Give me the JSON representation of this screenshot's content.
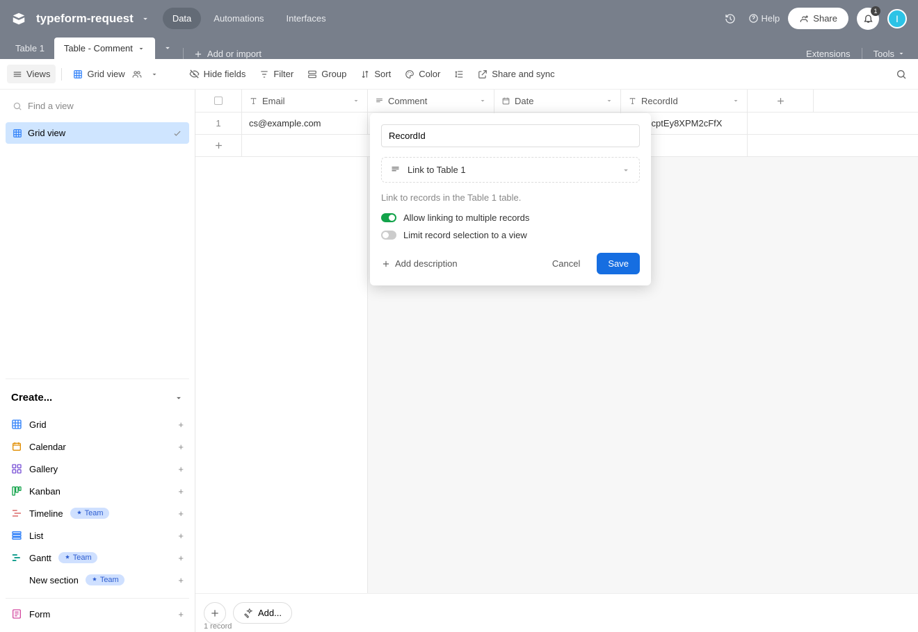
{
  "header": {
    "base_name": "typeform-request",
    "tabs": {
      "data": "Data",
      "automations": "Automations",
      "interfaces": "Interfaces"
    },
    "help": "Help",
    "share": "Share",
    "notif_count": "1",
    "avatar_initial": "I"
  },
  "tabbar": {
    "tabs": [
      "Table 1",
      "Table - Comment"
    ],
    "add_or_import": "Add or import",
    "extensions": "Extensions",
    "tools": "Tools"
  },
  "toolbar": {
    "views": "Views",
    "grid_view": "Grid view",
    "hide_fields": "Hide fields",
    "filter": "Filter",
    "group": "Group",
    "sort": "Sort",
    "color": "Color",
    "share_sync": "Share and sync"
  },
  "sidebar": {
    "find_placeholder": "Find a view",
    "active_view": "Grid view",
    "create_header": "Create...",
    "items": [
      {
        "label": "Grid",
        "color": "#2d7ff9"
      },
      {
        "label": "Calendar",
        "color": "#e08d00"
      },
      {
        "label": "Gallery",
        "color": "#7a52d6"
      },
      {
        "label": "Kanban",
        "color": "#12a34a"
      },
      {
        "label": "Timeline",
        "color": "#d44a4a",
        "team": true
      },
      {
        "label": "List",
        "color": "#2d7ff9"
      },
      {
        "label": "Gantt",
        "color": "#1aa191",
        "team": true
      },
      {
        "label": "New section",
        "color": "#555",
        "team": true,
        "no_icon": true
      }
    ],
    "form_label": "Form",
    "team_label": "Team"
  },
  "grid": {
    "columns": [
      "Email",
      "Comment",
      "Date",
      "RecordId"
    ],
    "rows": [
      {
        "num": "1",
        "email": "cs@example.com",
        "comment": "",
        "date": "",
        "recordid": "recptEy8XPM2cFfX"
      }
    ],
    "record_count": "1 record",
    "add_label": "Add..."
  },
  "popup": {
    "field_name": "RecordId",
    "field_type": "Link to Table 1",
    "hint": "Link to records in the Table 1 table.",
    "allow_multiple": "Allow linking to multiple records",
    "limit_view": "Limit record selection to a view",
    "add_description": "Add description",
    "cancel": "Cancel",
    "save": "Save"
  }
}
